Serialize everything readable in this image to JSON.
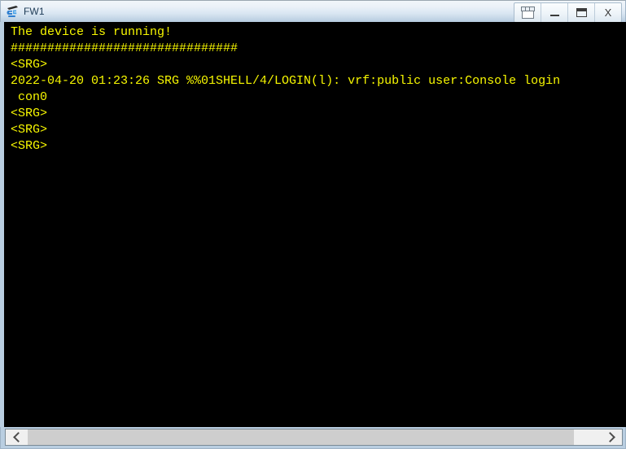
{
  "window": {
    "title": "FW1",
    "app_icon": "router-icon"
  },
  "titlebar_buttons": [
    {
      "name": "restore-group-button",
      "icon": "restore-windows-icon",
      "label": ""
    },
    {
      "name": "minimize-button",
      "icon": "minimize-icon",
      "label": ""
    },
    {
      "name": "maximize-button",
      "icon": "maximize-icon",
      "label": ""
    },
    {
      "name": "close-button",
      "icon": "close-icon",
      "label": "X"
    }
  ],
  "terminal": {
    "foreground_color": "#f8f800",
    "background_color": "#000000",
    "content": "The device is running!\n###############################\n<SRG>\n2022-04-20 01:23:26 SRG %%01SHELL/4/LOGIN(l): vrf:public user:Console login\n con0\n<SRG>\n<SRG>\n<SRG>",
    "lines": [
      "The device is running!",
      "###############################",
      "<SRG>",
      "2022-04-20 01:23:26 SRG %%01SHELL/4/LOGIN(l): vrf:public user:Console login",
      " con0",
      "<SRG>",
      "<SRG>",
      "<SRG>"
    ]
  },
  "scrollbar": {
    "orientation": "horizontal",
    "left_arrow": "‹",
    "right_arrow": "›",
    "thumb_position_percent": 0,
    "thumb_width_percent": 95
  }
}
